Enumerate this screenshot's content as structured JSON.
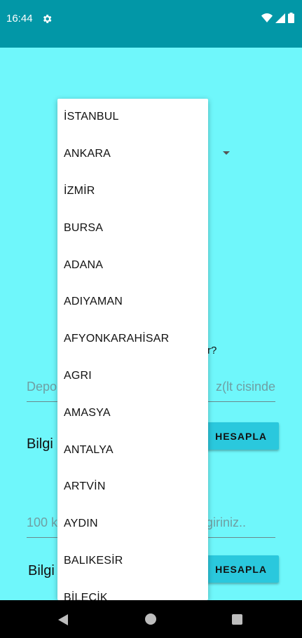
{
  "status_bar": {
    "time": "16:44",
    "icons": [
      "gear-icon",
      "wifi-icon",
      "cell-signal-icon",
      "battery-icon"
    ]
  },
  "form": {
    "question_fragment": "r?",
    "field1": {
      "placeholder_left": "Depo",
      "placeholder_right": "z(lt cisinde"
    },
    "field2": {
      "placeholder_left": "100 k",
      "placeholder_right": "i giriniz.."
    },
    "bilgi_1": "Bilgi",
    "bilgi_2": "Bilgi",
    "button1_label": "HESAPLA",
    "button2_label": "HESAPLA"
  },
  "dropdown": {
    "items": [
      "İSTANBUL",
      "ANKARA",
      "İZMİR",
      "BURSA",
      "ADANA",
      "ADIYAMAN",
      "AFYONKARAHİSAR",
      "AGRI",
      "AMASYA",
      "ANTALYA",
      "ARTVİN",
      "AYDIN",
      "BALIKESİR",
      "BİLECİK"
    ]
  },
  "colors": {
    "status_bar": "#0297a7",
    "background": "#6ff7fb",
    "button": "#2ac8dd"
  }
}
